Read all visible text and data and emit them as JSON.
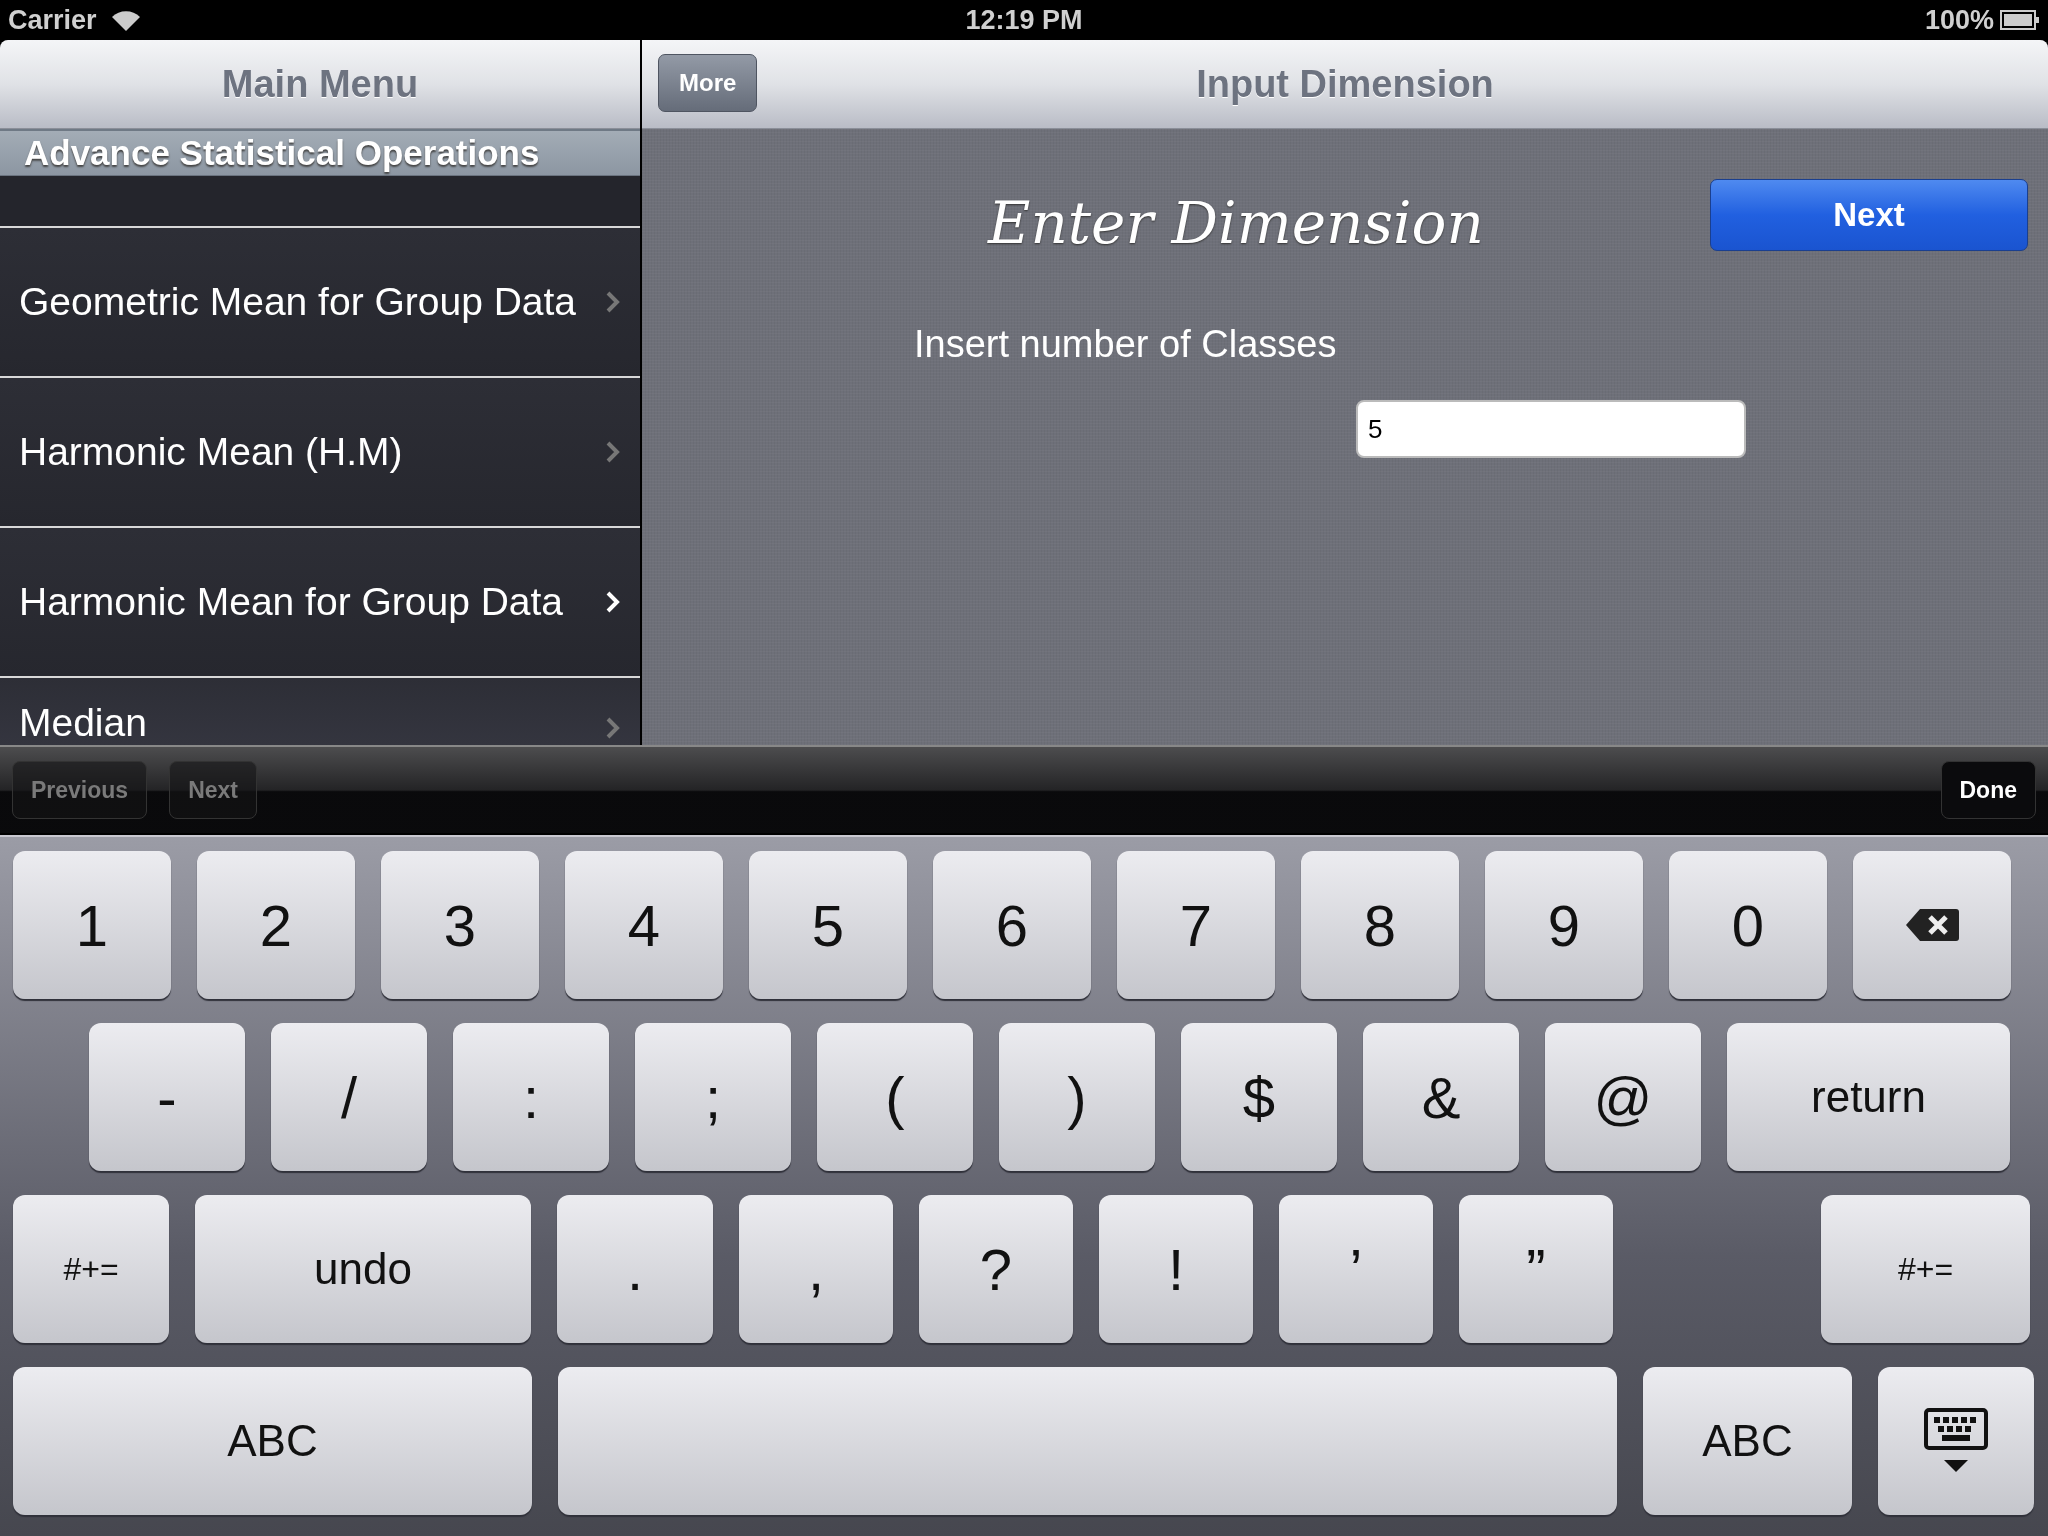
{
  "status_bar": {
    "carrier": "Carrier",
    "time": "12:19 PM",
    "battery": "100%"
  },
  "master": {
    "title": "Main Menu",
    "section_header": "Advance Statistical Operations",
    "items": [
      {
        "label": "Geometric Mean for Group Data",
        "selected": false
      },
      {
        "label": "Harmonic Mean (H.M)",
        "selected": false
      },
      {
        "label": "Harmonic Mean for Group Data",
        "selected": true
      },
      {
        "label": "Median",
        "selected": false
      }
    ]
  },
  "detail": {
    "title": "Input Dimension",
    "back_button": "More",
    "heading": "Enter Dimension",
    "next_button": "Next",
    "prompt": "Insert number of Classes",
    "field": {
      "value": "5"
    }
  },
  "input_accessory": {
    "buttons": [
      {
        "label": "Previous",
        "disabled": true
      },
      {
        "label": "Next",
        "disabled": true
      }
    ],
    "done": "Done"
  },
  "keyboard": {
    "rows": [
      [
        {
          "label": "1",
          "kind": "char"
        },
        {
          "label": "2",
          "kind": "char"
        },
        {
          "label": "3",
          "kind": "char"
        },
        {
          "label": "4",
          "kind": "char"
        },
        {
          "label": "5",
          "kind": "char"
        },
        {
          "label": "6",
          "kind": "char"
        },
        {
          "label": "7",
          "kind": "char"
        },
        {
          "label": "8",
          "kind": "char"
        },
        {
          "label": "9",
          "kind": "char"
        },
        {
          "label": "0",
          "kind": "char"
        },
        {
          "kind": "delete"
        }
      ],
      [
        {
          "label": "-",
          "kind": "char"
        },
        {
          "label": "/",
          "kind": "char"
        },
        {
          "label": ":",
          "kind": "char"
        },
        {
          "label": ";",
          "kind": "char"
        },
        {
          "label": "(",
          "kind": "char"
        },
        {
          "label": ")",
          "kind": "char"
        },
        {
          "label": "$",
          "kind": "char"
        },
        {
          "label": "&",
          "kind": "char"
        },
        {
          "label": "@",
          "kind": "char"
        },
        {
          "label": "return",
          "kind": "word"
        }
      ],
      [
        {
          "label": "#+=",
          "kind": "small"
        },
        {
          "label": "undo",
          "kind": "word"
        },
        {
          "label": ".",
          "kind": "char"
        },
        {
          "label": ",",
          "kind": "char"
        },
        {
          "label": "?",
          "kind": "char"
        },
        {
          "label": "!",
          "kind": "char"
        },
        {
          "label": "’",
          "kind": "char"
        },
        {
          "label": "”",
          "kind": "char"
        },
        {
          "label": "#+=",
          "kind": "small"
        }
      ],
      [
        {
          "label": "ABC",
          "kind": "word"
        },
        {
          "kind": "space"
        },
        {
          "label": "ABC",
          "kind": "word"
        },
        {
          "kind": "hide"
        }
      ]
    ]
  }
}
